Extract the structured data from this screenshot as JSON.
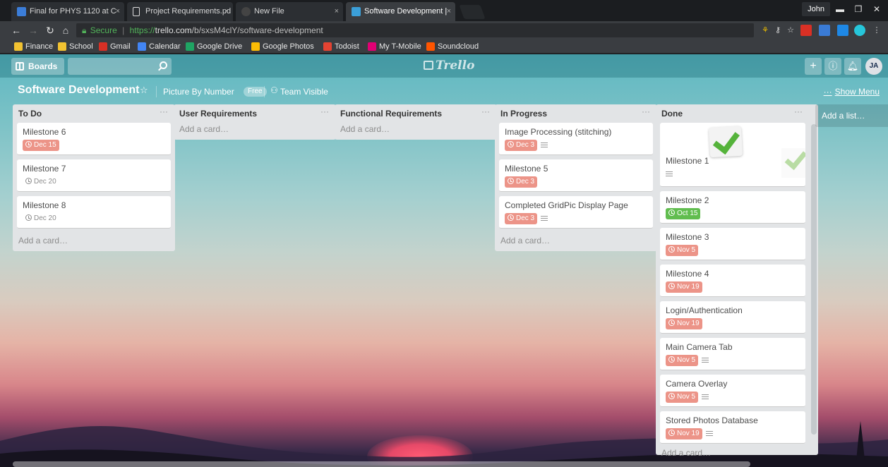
{
  "browser": {
    "tabs": [
      {
        "title": "Final for PHYS 1120 at C",
        "close": "×",
        "color": "#3b7dd8"
      },
      {
        "title": "Project Requirements.pd",
        "close": "×",
        "color": "#e0e0e0"
      },
      {
        "title": "New File",
        "close": "×",
        "color": "#888888"
      },
      {
        "title": "Software Development |",
        "close": "×",
        "color": "#3b9fd8"
      }
    ],
    "user": "John",
    "url": {
      "secure_label": "Secure",
      "scheme": "https://",
      "host": "trello.com",
      "path": "/b/sxsM4clY/software-development"
    },
    "bookmarks": [
      {
        "label": "Finance",
        "color": "#f2c231"
      },
      {
        "label": "School",
        "color": "#f2c231"
      },
      {
        "label": "Gmail",
        "color": "#d93025"
      },
      {
        "label": "Calendar",
        "color": "#4285f4"
      },
      {
        "label": "Google Drive",
        "color": "#1fa463"
      },
      {
        "label": "Google Photos",
        "color": "#fbbc05"
      },
      {
        "label": "Todoist",
        "color": "#e44332"
      },
      {
        "label": "My T-Mobile",
        "color": "#e20074"
      },
      {
        "label": "Soundcloud",
        "color": "#ff5500"
      }
    ]
  },
  "header": {
    "boards_label": "Boards",
    "search_value": "",
    "logo": "Trello",
    "avatar_initials": "JA"
  },
  "board": {
    "title": "Software Development",
    "team": "Picture By Number",
    "plan_badge": "Free",
    "visibility": "Team Visible",
    "show_menu": "Show Menu",
    "add_list": "Add a list…"
  },
  "lists": [
    {
      "title": "To Do",
      "cards": [
        {
          "title": "Milestone 6",
          "due": "Dec 15",
          "due_style": "overdue",
          "desc": false
        },
        {
          "title": "Milestone 7",
          "due": "Dec 20",
          "due_style": "plain",
          "desc": false
        },
        {
          "title": "Milestone 8",
          "due": "Dec 20",
          "due_style": "plain",
          "desc": false
        }
      ],
      "add_card": "Add a card…"
    },
    {
      "title": "User Requirements",
      "cards": [],
      "add_card": "Add a card…"
    },
    {
      "title": "Functional Requirements",
      "cards": [],
      "add_card": "Add a card…"
    },
    {
      "title": "In Progress",
      "cards": [
        {
          "title": "Image Processing (stitching)",
          "due": "Dec 3",
          "due_style": "overdue",
          "desc": true
        },
        {
          "title": "Milestone 5",
          "due": "Dec 3",
          "due_style": "overdue",
          "desc": false
        },
        {
          "title": "Completed GridPic Display Page",
          "due": "Dec 3",
          "due_style": "overdue",
          "desc": true
        }
      ],
      "add_card": "Add a card…"
    },
    {
      "title": "Done",
      "cards": [
        {
          "title": "Milestone 1",
          "due": "",
          "due_style": "none",
          "desc": true,
          "cover": true
        },
        {
          "title": "Milestone 2",
          "due": "Oct 15",
          "due_style": "complete",
          "desc": false
        },
        {
          "title": "Milestone 3",
          "due": "Nov 5",
          "due_style": "overdue",
          "desc": false
        },
        {
          "title": "Milestone 4",
          "due": "Nov 19",
          "due_style": "overdue",
          "desc": false
        },
        {
          "title": "Login/Authentication",
          "due": "Nov 19",
          "due_style": "overdue",
          "desc": false
        },
        {
          "title": "Main Camera Tab",
          "due": "Nov 5",
          "due_style": "overdue",
          "desc": true
        },
        {
          "title": "Camera Overlay",
          "due": "Nov 5",
          "due_style": "overdue",
          "desc": true
        },
        {
          "title": "Stored Photos Database",
          "due": "Nov 19",
          "due_style": "overdue",
          "desc": true
        }
      ],
      "add_card": "Add a card…"
    }
  ],
  "colors": {
    "overdue": "#ec9488",
    "complete": "#61bd4f",
    "list_bg": "#e2e4e6"
  }
}
